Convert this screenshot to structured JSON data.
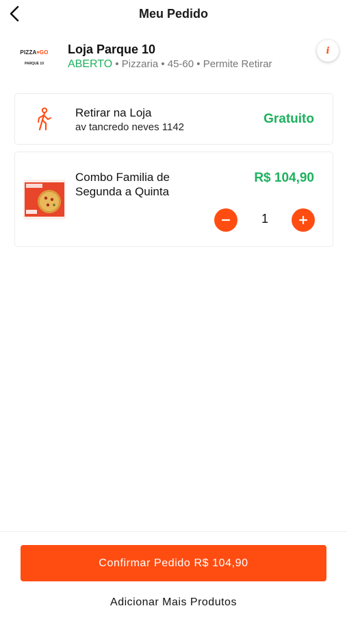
{
  "header": {
    "title": "Meu Pedido",
    "back_icon": "chevron-left-icon"
  },
  "store": {
    "logo_text_pizza": "PIZZA",
    "logo_text_go": "GO",
    "logo_text_bottom": "PARQUE 10",
    "name": "Loja Parque 10",
    "status": "ABERTO",
    "meta": " • Pizzaria • 45-60 • Permite Retirar",
    "info_icon": "i",
    "status_color": "#1db15e"
  },
  "pickup": {
    "icon": "walking-person-icon",
    "title": "Retirar na Loja",
    "address": "av tancredo neves  1142",
    "price": "Gratuito"
  },
  "item": {
    "name": "Combo Familia de Segunda a Quinta",
    "price": "R$ 104,90",
    "quantity": "1",
    "thumb_icon": "pizza-box-image"
  },
  "footer": {
    "confirm_label": "Confirmar Pedido R$ 104,90",
    "add_more_label": "Adicionar Mais Produtos"
  },
  "colors": {
    "accent": "#ff4d12",
    "price_green": "#1db15e"
  }
}
